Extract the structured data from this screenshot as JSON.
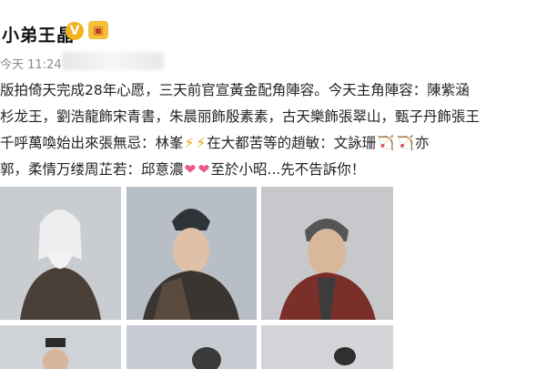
{
  "post": {
    "author": "小弟王晶",
    "time": "今天 11:24",
    "lines": [
      "版拍倚天完成28年心愿，三天前官宣黃金配角陣容。今天主角陣容：陳紫涵",
      "杉龙王，劉浩龍飾宋青書，朱晨丽飾殷素素，古天樂飾張翠山，甄子丹飾張王",
      "千呼萬喚始出來張無忌：林峯",
      "在大都苦等的趙敏：文詠珊",
      "亦",
      "郭，柔情万缕周芷若：邱意濃",
      "至於小昭...先不告訴你！"
    ]
  },
  "icons": {
    "verified": "verified-v-icon",
    "member": "member-badge-icon",
    "bolt": "lightning-emoji",
    "bow": "bow-emoji",
    "heart": "heart-emoji"
  },
  "colors": {
    "verified": "#f2b21a",
    "muted": "#8a8a8a",
    "photo_bg": "#cfd2d6"
  }
}
